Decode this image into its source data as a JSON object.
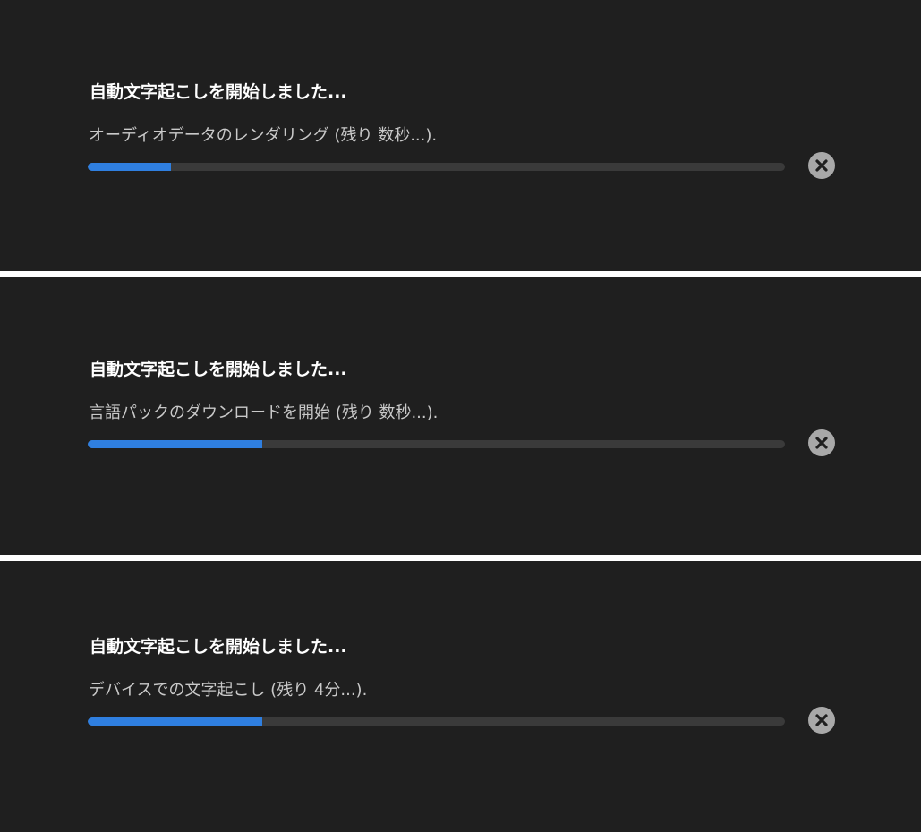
{
  "dialogs": [
    {
      "title": "自動文字起こしを開始しました...",
      "status": "オーディオデータのレンダリング (残り 数秒...).",
      "progress_percent": 12,
      "cancel_icon": "close-circle-icon"
    },
    {
      "title": "自動文字起こしを開始しました...",
      "status": "言語パックのダウンロードを開始 (残り 数秒...).",
      "progress_percent": 25,
      "cancel_icon": "close-circle-icon"
    },
    {
      "title": "自動文字起こしを開始しました...",
      "status": "デバイスでの文字起こし (残り 4分...).",
      "progress_percent": 25,
      "cancel_icon": "close-circle-icon"
    }
  ],
  "colors": {
    "background": "#1f1f1f",
    "separator": "#ffffff",
    "progress_fill": "#2f7fe0",
    "progress_track": "#3a3a3a",
    "cancel_button": "#a8a8a8"
  }
}
